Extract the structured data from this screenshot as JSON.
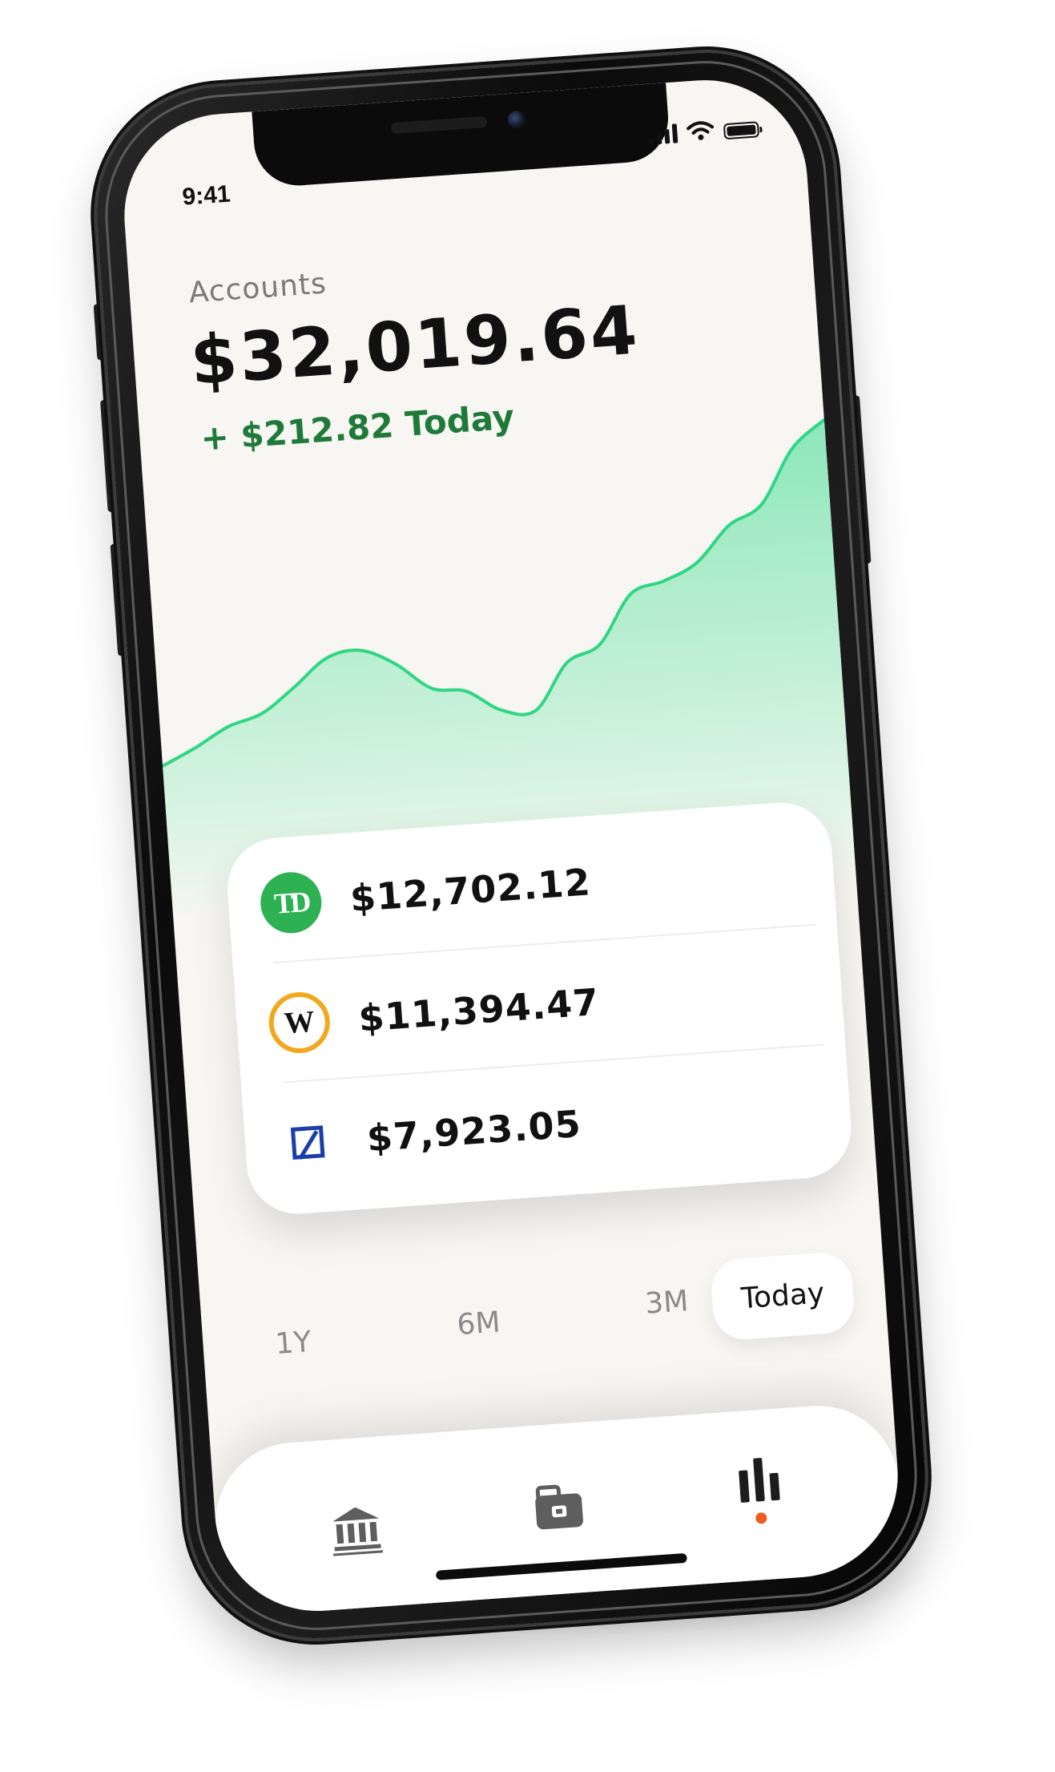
{
  "status_bar": {
    "time": "9:41",
    "icons": [
      "cellular-signal-icon",
      "wifi-icon",
      "battery-icon"
    ]
  },
  "header": {
    "label": "Accounts",
    "balance": "$32,019.64",
    "change_today": "+ $212.82 Today"
  },
  "colors": {
    "accent_green": "#2ecc71",
    "change_green": "#1f7a3a",
    "td_green": "#2db152",
    "w_gold": "#f2a81d",
    "db_blue": "#1a3fa8",
    "nav_dot": "#ef5b1f"
  },
  "accounts": [
    {
      "logo_text": "TD",
      "amount": "$12,702.12"
    },
    {
      "logo_text": "W",
      "amount": "$11,394.47"
    },
    {
      "logo_text": "",
      "amount": "$7,923.05"
    }
  ],
  "ranges": {
    "items": [
      "1Y",
      "6M",
      "3M",
      "Today"
    ],
    "selected": "Today"
  },
  "bottom_nav": {
    "items": [
      "bank-icon",
      "wallet-icon",
      "bar-chart-icon"
    ],
    "active": "bar-chart-icon"
  },
  "chart_data": {
    "type": "area",
    "title": "",
    "xlabel": "",
    "ylabel": "",
    "grid": false,
    "x": [
      0,
      1,
      2,
      3,
      4,
      5,
      6,
      7,
      8,
      9,
      10,
      11,
      12,
      13,
      14,
      15,
      16,
      17,
      18,
      19,
      20
    ],
    "values": [
      28,
      34,
      41,
      45,
      54,
      64,
      66,
      60,
      50,
      48,
      40,
      39,
      56,
      62,
      80,
      84,
      90,
      103,
      110,
      130,
      140
    ],
    "ylim": [
      0,
      150
    ]
  }
}
